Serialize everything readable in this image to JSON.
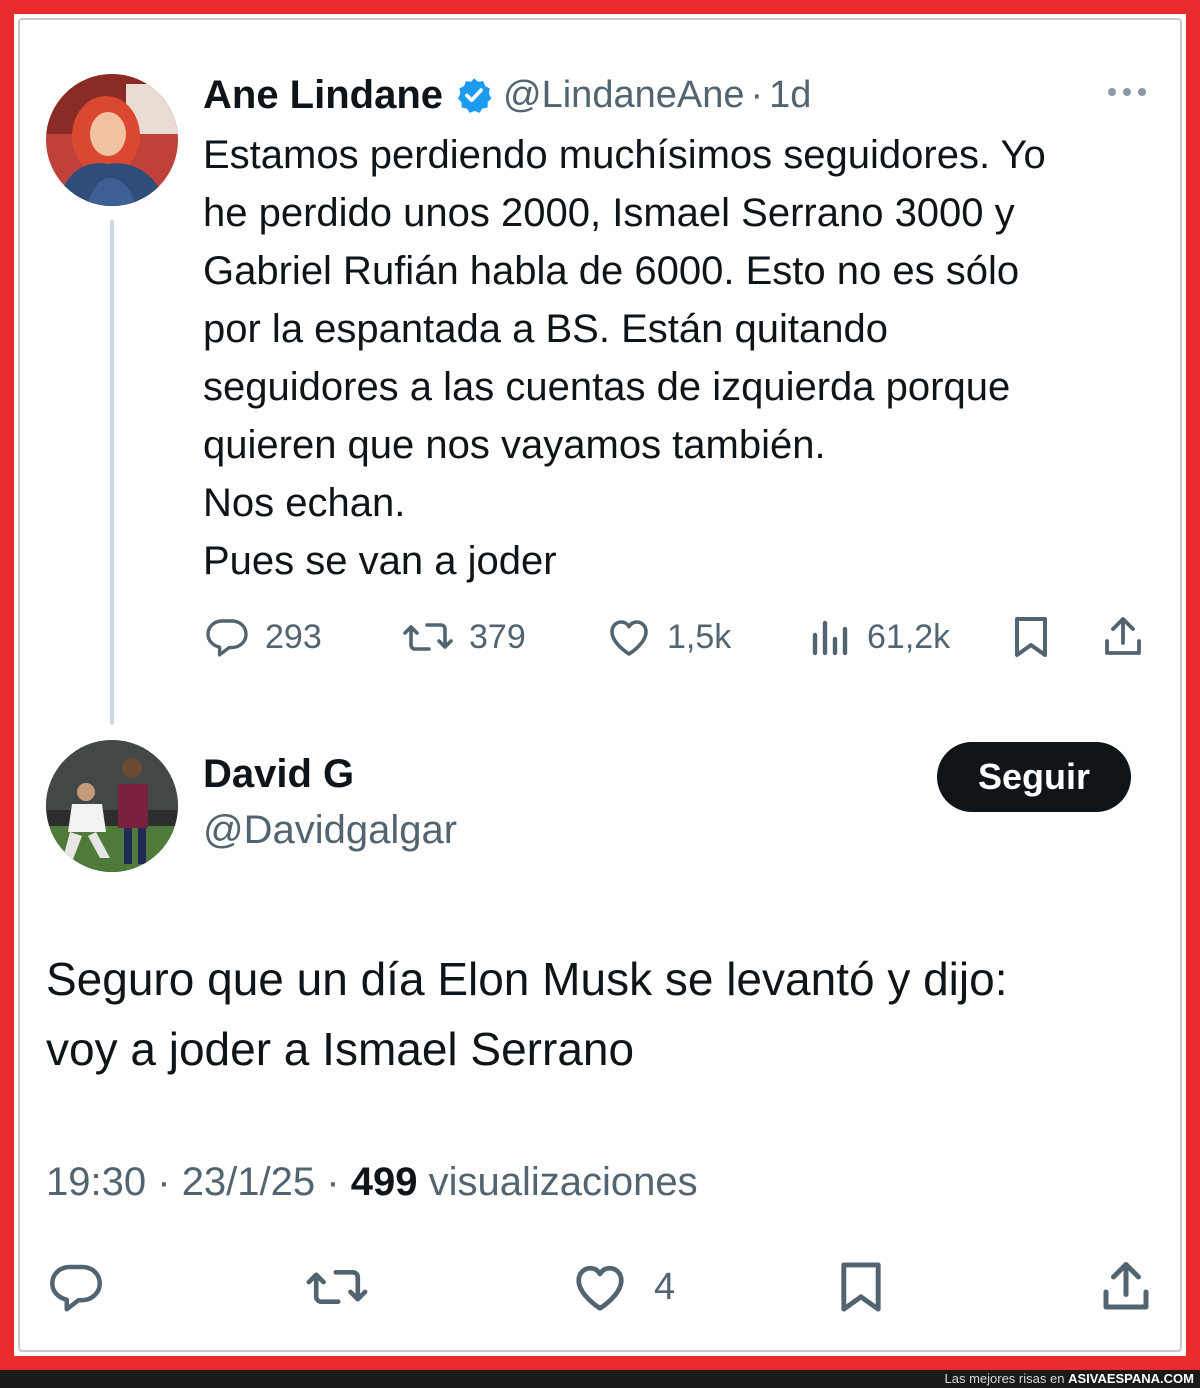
{
  "original_tweet": {
    "author_name": "Ane Lindane",
    "handle": "@LindaneAne",
    "separator": "·",
    "time": "1d",
    "verified": true,
    "text_lines": [
      "Estamos perdiendo muchísimos seguidores. Yo",
      "he perdido unos 2000, Ismael Serrano 3000 y",
      "Gabriel Rufián habla de 6000. Esto no es sólo",
      "por la espantada a BS. Están quitando",
      "seguidores a las cuentas de izquierda porque",
      "quieren que nos vayamos también.",
      "Nos echan.",
      "Pues se van a joder"
    ],
    "stats": {
      "replies": "293",
      "reposts": "379",
      "likes": "1,5k",
      "views": "61,2k"
    }
  },
  "reply_tweet": {
    "author_name": "David G",
    "handle": "@Davidgalgar",
    "follow_label": "Seguir",
    "text_lines": [
      "Seguro que un día Elon Musk se levantó y dijo:",
      "voy a joder a Ismael Serrano"
    ],
    "time": "19:30",
    "date": "23/1/25",
    "separator": "·",
    "views_count": "499",
    "views_label": "visualizaciones",
    "likes": "4"
  },
  "footer": {
    "prefix": "Las mejores risas en",
    "site": "ASIVAESPANA.COM"
  },
  "colors": {
    "frame_red": "#ea2b2b",
    "text_primary": "#0f1419",
    "text_secondary": "#536471",
    "verified_blue": "#1d9bf0",
    "thread_line": "#cfd9de"
  },
  "icons": [
    "verified-badge-icon",
    "more-icon",
    "reply-icon",
    "repost-icon",
    "like-icon",
    "views-icon",
    "bookmark-icon",
    "share-icon"
  ]
}
